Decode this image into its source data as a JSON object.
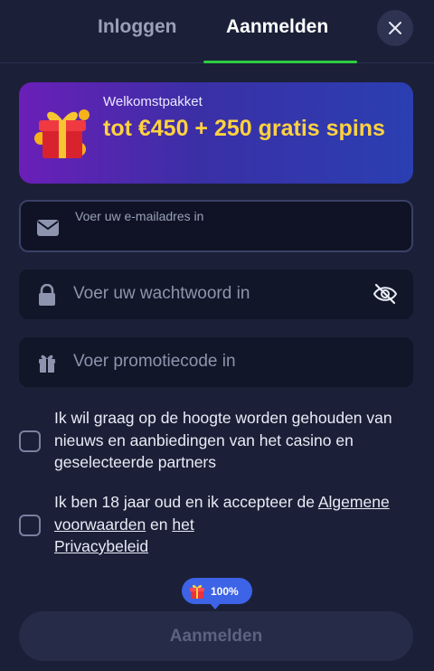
{
  "tabs": {
    "login": "Inloggen",
    "register": "Aanmelden"
  },
  "banner": {
    "small": "Welkomstpakket",
    "big": "tot €450 + 250 gratis spins"
  },
  "fields": {
    "email_label": "Voer uw e-mailadres in",
    "password_placeholder": "Voer uw wachtwoord in",
    "promo_placeholder": "Voer promotiecode in"
  },
  "checks": {
    "newsletter": "Ik wil graag op de hoogte worden gehouden van nieuws en aanbiedingen van het casino en geselecteerde partners",
    "age_prefix": "Ik ben 18 jaar oud en ik accepteer de ",
    "terms_link": "Algemene voorwaarden",
    "and": " en ",
    "privacy_link1": "het",
    "privacy_link2": "Privacybeleid"
  },
  "badge": {
    "text": "100%"
  },
  "submit": {
    "label": "Aanmelden"
  },
  "colors": {
    "accent_green": "#2ecc40",
    "banner_yellow": "#ffd23e",
    "badge_blue": "#3d63e6"
  }
}
